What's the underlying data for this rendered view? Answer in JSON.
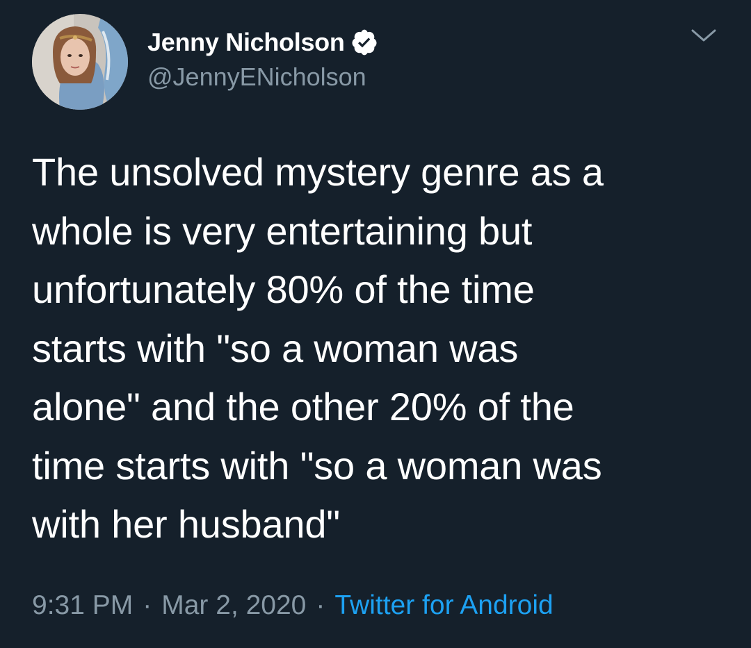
{
  "author": {
    "name": "Jenny Nicholson",
    "handle": "@JennyENicholson",
    "verified": true,
    "avatar_icon": "profile-photo"
  },
  "tweet": {
    "lines": [
      "The unsolved mystery genre as a",
      "whole is very entertaining but",
      "unfortunately 80% of the time",
      "starts with \"so a woman was",
      "alone\" and the other 20% of the",
      "time starts with \"so a woman was",
      "with her husband\""
    ]
  },
  "meta": {
    "time": "9:31 PM",
    "separator": "·",
    "date": "Mar 2, 2020",
    "source": "Twitter for Android"
  },
  "colors": {
    "background": "#15202b",
    "text": "#ffffff",
    "secondary": "#8899a6",
    "accent": "#1da1f2"
  },
  "icons": {
    "verified": "verified-badge-icon",
    "menu": "chevron-down-icon"
  }
}
